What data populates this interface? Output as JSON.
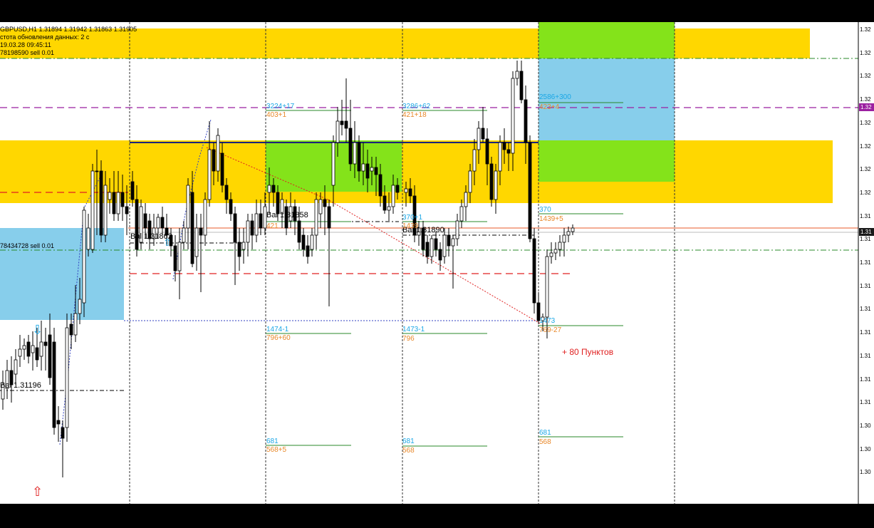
{
  "header": {
    "symbol_line": "GBPUSD,H1  1.31894 1.31942 1.31863 1.31905",
    "update_freq": "стота обновления данных: 2 с",
    "datetime": "19.03.28 09:45:11",
    "order": "78198590 sell 0.01"
  },
  "orders": {
    "left_order": "78434728 sell 0.01"
  },
  "price_axis": {
    "labels": [
      "1.32",
      "1.32",
      "1.32",
      "1.32",
      "1.32",
      "1.32",
      "1.32",
      "1.32",
      "1.31",
      "1.31",
      "1.31",
      "1.31",
      "1.31",
      "1.31",
      "1.31",
      "1.31",
      "1.31",
      "1.30",
      "1.30",
      "1.30"
    ],
    "current_tag_purple": "1.32",
    "current_tag_dark": "1.31",
    "purple_color": "#9b1fa0",
    "dark_color": "#1a1a1a"
  },
  "bal_labels": {
    "bal1": "Bal 1.31196",
    "bal2": "Bal 1.31862",
    "bal3": "Bal 1.31858",
    "bal4": "Bal 1.31890"
  },
  "column_stats": {
    "c1_top_blue": "3224+17",
    "c1_top_orange": "403+1",
    "c1_mid_orange": "421",
    "c1_low_blue": "1474-1",
    "c1_low_orange": "796+60",
    "c1_bot_blue": "681",
    "c1_bot_orange": "568+5",
    "c2_top_blue": "3286+62",
    "c2_top_orange": "421+18",
    "c2_mid_blue": "370+1",
    "c2_mid_orange": "1439",
    "c2_low_blue": "1473-1",
    "c2_low_orange": "796",
    "c2_bot_blue": "681",
    "c2_bot_orange": "568",
    "c3_top_blue": "2586+300",
    "c3_top_orange": "423+4",
    "c3_mid_blue": "370",
    "c3_mid_orange": "1439+5",
    "c3_low_blue": "1473",
    "c3_low_orange": "769-27",
    "c3_bot_blue": "681",
    "c3_bot_orange": "568"
  },
  "profit_text": "+ 80 Пунктов",
  "colors": {
    "zone_yellow": "#ffd700",
    "zone_green": "#84e31a",
    "zone_blue": "#87ceeb",
    "bull": "#ffffff",
    "bear": "#000000"
  }
}
